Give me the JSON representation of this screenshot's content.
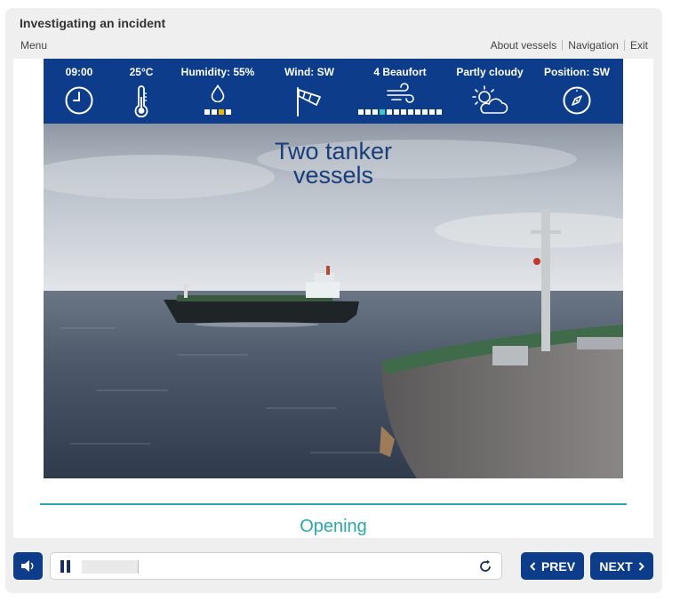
{
  "header": {
    "title": "Investigating an incident",
    "menu_label": "Menu",
    "links": [
      "About vessels",
      "Navigation",
      "Exit"
    ]
  },
  "weather": {
    "time": "09:00",
    "temperature": "25°C",
    "humidity": "Humidity: 55%",
    "wind": "Wind: SW",
    "beaufort": "4 Beaufort",
    "sky": "Partly cloudy",
    "position": "Position: SW",
    "humidity_level": 3,
    "humidity_scale_max": 4,
    "beaufort_level": 4,
    "beaufort_scale_max": 12,
    "icons": [
      "clock-icon",
      "thermometer-icon",
      "droplet-icon",
      "windsock-icon",
      "wind-icon",
      "partly-cloudy-icon",
      "compass-icon"
    ]
  },
  "scene": {
    "caption_line1": "Two tanker",
    "caption_line2": "vessels"
  },
  "section": {
    "title": "Opening"
  },
  "player": {
    "progress_fraction": 0.12
  },
  "nav": {
    "prev_label": "PREV",
    "next_label": "NEXT"
  },
  "colors": {
    "brand_blue": "#0d3d8a",
    "accent_teal": "#2aa6b3",
    "humidity_fill": "#f2b400",
    "beaufort_fill": "#3cc8c8"
  }
}
